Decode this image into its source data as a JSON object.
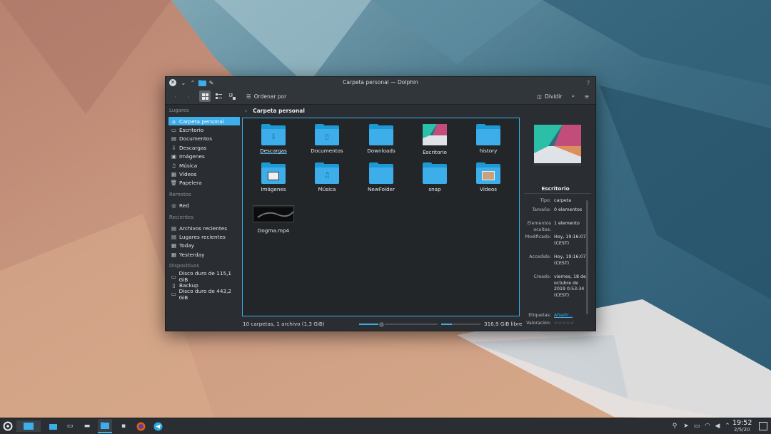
{
  "window": {
    "title": "Carpeta personal — Dolphin"
  },
  "toolbar": {
    "sort_label": "Ordenar por",
    "split_label": "Dividir"
  },
  "breadcrumb": {
    "location": "Carpeta personal"
  },
  "sidebar": {
    "places_header": "Lugares",
    "places": [
      {
        "label": "Carpeta personal",
        "icon": "home-icon",
        "glyph": "⌂"
      },
      {
        "label": "Escritorio",
        "icon": "desktop-icon",
        "glyph": "▭"
      },
      {
        "label": "Documentos",
        "icon": "document-icon",
        "glyph": "▤"
      },
      {
        "label": "Descargas",
        "icon": "download-icon",
        "glyph": "⇩"
      },
      {
        "label": "Imágenes",
        "icon": "image-icon",
        "glyph": "▣"
      },
      {
        "label": "Música",
        "icon": "music-icon",
        "glyph": "♫"
      },
      {
        "label": "Vídeos",
        "icon": "video-icon",
        "glyph": "▦"
      },
      {
        "label": "Papelera",
        "icon": "trash-icon",
        "glyph": "🗑"
      }
    ],
    "remote_header": "Remotos",
    "remote": [
      {
        "label": "Red",
        "icon": "network-icon",
        "glyph": "◎"
      }
    ],
    "recent_header": "Recientes",
    "recent": [
      {
        "label": "Archivos recientes",
        "icon": "recent-files-icon",
        "glyph": "▤"
      },
      {
        "label": "Lugares recientes",
        "icon": "recent-places-icon",
        "glyph": "▤"
      },
      {
        "label": "Today",
        "icon": "calendar-icon",
        "glyph": "▦"
      },
      {
        "label": "Yesterday",
        "icon": "calendar-icon",
        "glyph": "▦"
      }
    ],
    "devices_header": "Dispositivos",
    "devices": [
      {
        "label": "Disco duro de 115,1 GiB",
        "icon": "harddisk-icon",
        "glyph": "▭"
      },
      {
        "label": "Backup",
        "icon": "usb-drive-icon",
        "glyph": "▯"
      },
      {
        "label": "Disco duro de 443,2 GiB",
        "icon": "harddisk-icon",
        "glyph": "▭"
      }
    ]
  },
  "files": [
    {
      "name": "Descargas",
      "kind": "folder",
      "glyph": "⇩"
    },
    {
      "name": "Documentos",
      "kind": "folder",
      "glyph": "▯"
    },
    {
      "name": "Downloads",
      "kind": "folder",
      "glyph": ""
    },
    {
      "name": "Escritorio",
      "kind": "desktop-thumb",
      "glyph": ""
    },
    {
      "name": "history",
      "kind": "folder",
      "glyph": ""
    },
    {
      "name": "Imágenes",
      "kind": "folder-images",
      "glyph": ""
    },
    {
      "name": "Música",
      "kind": "folder",
      "glyph": "♫"
    },
    {
      "name": "NewFolder",
      "kind": "folder",
      "glyph": ""
    },
    {
      "name": "snap",
      "kind": "folder",
      "glyph": ""
    },
    {
      "name": "Vídeos",
      "kind": "folder-videos",
      "glyph": ""
    },
    {
      "name": "Dogma.mp4",
      "kind": "video",
      "glyph": ""
    }
  ],
  "info_panel": {
    "name": "Escritorio",
    "properties": [
      {
        "key": "Tipo:",
        "value": "carpeta"
      },
      {
        "key": "Tamaño:",
        "value": "0 elementos"
      },
      {
        "key": "Elementos ocultos:",
        "value": "1 elemento"
      },
      {
        "key": "Modificado:",
        "value": "Hoy, 19:16:07 (CEST)"
      },
      {
        "key": "Accedido:",
        "value": "Hoy, 19:16:07 (CEST)"
      },
      {
        "key": "Creado:",
        "value": "viernes, 18 de octubre de 2019 0:53:34 (CEST)"
      },
      {
        "key": "Etiquetas:",
        "value": "Añadir..."
      },
      {
        "key": "Valoración:",
        "value": "☆☆☆☆☆"
      }
    ]
  },
  "status": {
    "summary": "10 carpetas, 1 archivo (1,3 GiB)",
    "free_space": "316,9 GiB libre",
    "zoom_level": 0.28,
    "disk_used_fraction": 0.28
  },
  "taskbar": {
    "time": "19:52",
    "date": "2/5/20"
  },
  "colors": {
    "accent": "#3daee9",
    "window_bg": "#2a2e32",
    "view_bg": "#232629"
  }
}
